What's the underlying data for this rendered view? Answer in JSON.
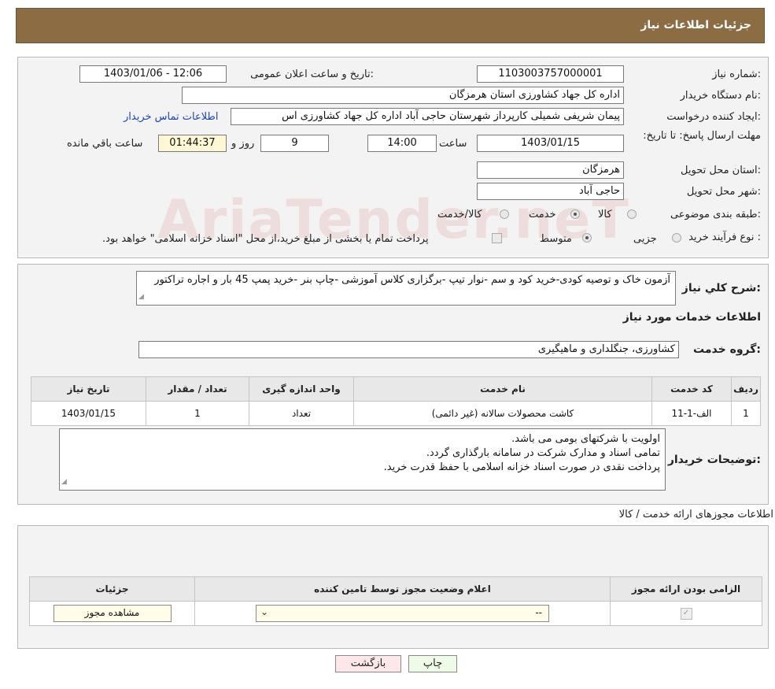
{
  "header": {
    "title": "جزئیات اطلاعات نیاز"
  },
  "info": {
    "need_number_label": "شماره نیاز:",
    "need_number": "1103003757000001",
    "announce_label": "تاریخ و ساعت اعلان عمومی:",
    "announce_value": "1403/01/06 - 12:06",
    "buyer_org_label": "نام دستگاه خریدار:",
    "buyer_org": "اداره کل جهاد کشاورزی استان هرمزگان",
    "requester_label": "ایجاد کننده درخواست:",
    "requester": "پیمان شریفی شمیلی کارپرداز شهرستان حاجی آباد اداره کل جهاد کشاورزی اس",
    "contact_link": "اطلاعات تماس خریدار",
    "deadline_label": "مهلت ارسال پاسخ: تا تاریخ:",
    "deadline_date": "1403/01/15",
    "time_label": "ساعت",
    "deadline_time": "14:00",
    "days_value": "9",
    "days_label": "روز و",
    "remaining_time": "01:44:37",
    "remaining_label": "ساعت باقي مانده",
    "province_label": "استان محل تحویل:",
    "province": "هرمزگان",
    "city_label": "شهر محل تحویل:",
    "city": "حاجی آباد",
    "category_label": "طبقه بندی موضوعی:",
    "category_options": [
      "کالا",
      "خدمت",
      "کالا/خدمت"
    ],
    "category_selected": "خدمت",
    "purchase_type_label": "نوع فرآیند خرید :",
    "purchase_options": [
      "جزیی",
      "متوسط"
    ],
    "purchase_selected": "متوسط",
    "payment_note": "پرداخت تمام یا بخشی از مبلغ خرید،از محل \"اسناد خزانه اسلامی\" خواهد بود."
  },
  "watermark": "AriaTender.neT",
  "description": {
    "label": "شرح كلي نياز:",
    "text": "آزمون خاک و توصیه کودی-خرید کود و سم -نوار تیپ -برگزاری کلاس آموزشی -چاپ بنر -خرید پمپ 45  بار و اجاره تراکتور"
  },
  "services": {
    "section_title": "اطلاعات خدمات مورد نیاز",
    "group_label": "گروه خدمت:",
    "group_value": "کشاورزی، جنگلداری و ماهیگیری",
    "table": {
      "columns": [
        "رديف",
        "کد خدمت",
        "نام خدمت",
        "واحد اندازه گیری",
        "تعداد / مقدار",
        "تاریخ نیاز"
      ],
      "rows": [
        [
          "1",
          "الف-1-11",
          "کاشت محصولات سالانه (غیر دائمی)",
          "تعداد",
          "1",
          "1403/01/15"
        ]
      ]
    }
  },
  "buyer_notes": {
    "label": "توضیحات خریدار:",
    "lines": [
      "اولویت با شرکتهای بومی می باشد.",
      "تمامی اسناد و مدارک شرکت در سامانه بارگذاری گردد.",
      "پرداخت نقدی در صورت اسناد خزانه اسلامی با حفظ قدرت خرید."
    ]
  },
  "permits": {
    "section_title": "اطلاعات مجوزهای ارائه خدمت / کالا",
    "columns": [
      "الزامی بودن ارائه مجوز",
      "اعلام وضعیت مجوز توسط تامین کننده",
      "جزئیات"
    ],
    "row": {
      "select_value": "--",
      "view_button": "مشاهده مجوز"
    }
  },
  "buttons": {
    "print": "چاپ",
    "back": "بازگشت"
  },
  "colors": {
    "header_bg": "#8b6c43",
    "link": "#1a44c2",
    "back_button": "#fde7ea",
    "print_button": "#eefbe6"
  }
}
